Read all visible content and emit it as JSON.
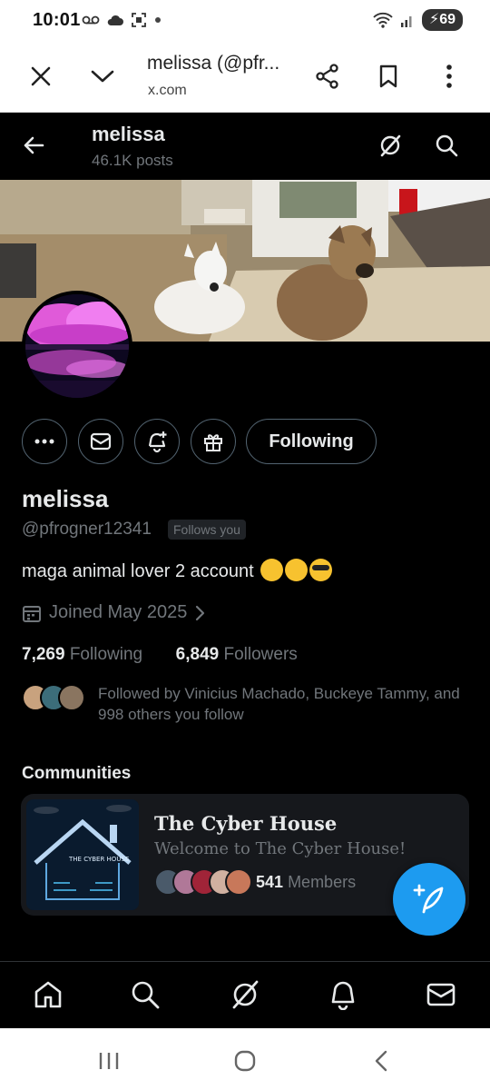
{
  "status_bar": {
    "time": "10:01",
    "battery": "69",
    "icons": [
      "voicemail-icon",
      "cloud-icon",
      "screenshot-icon",
      "dot-icon",
      "wifi-icon",
      "signal-icon",
      "battery-icon"
    ]
  },
  "browser": {
    "title": "melissa (@pfr...",
    "url": "x.com"
  },
  "header": {
    "name": "melissa",
    "posts": "46.1K posts"
  },
  "profile": {
    "name": "melissa",
    "handle": "@pfrogner12341",
    "follows_you": "Follows you",
    "bio": "maga animal lover 2 account",
    "joined": "Joined May 2025",
    "following_count": "7,269",
    "following_label": "Following",
    "followers_count": "6,849",
    "followers_label": "Followers",
    "followed_by": "Followed by Vinicius Machado, Buckeye Tammy, and 998 others you follow",
    "following_button": "Following"
  },
  "communities": {
    "title": "Communities",
    "items": [
      {
        "name": "The Cyber House",
        "description": "Welcome to The Cyber House!",
        "members_count": "541",
        "members_label": "Members",
        "image_text": "THE CYBER HOUSE"
      }
    ]
  },
  "colors": {
    "accent": "#1d9bf0",
    "background": "#000000",
    "muted": "#71767b"
  }
}
